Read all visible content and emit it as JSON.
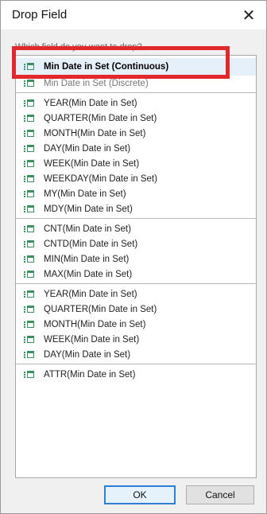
{
  "window": {
    "title": "Drop Field",
    "close_icon": "close-icon"
  },
  "prompt": "Which field do you want to drop?",
  "groups": [
    {
      "items": [
        {
          "label": "Min Date in Set (Continuous)",
          "selected": true
        },
        {
          "label": "Min Date in Set (Discrete)"
        }
      ]
    },
    {
      "items": [
        {
          "label": "YEAR(Min Date in Set)"
        },
        {
          "label": "QUARTER(Min Date in Set)"
        },
        {
          "label": "MONTH(Min Date in Set)"
        },
        {
          "label": "DAY(Min Date in Set)"
        },
        {
          "label": "WEEK(Min Date in Set)"
        },
        {
          "label": "WEEKDAY(Min Date in Set)"
        },
        {
          "label": "MY(Min Date in Set)"
        },
        {
          "label": "MDY(Min Date in Set)"
        }
      ]
    },
    {
      "items": [
        {
          "label": "CNT(Min Date in Set)"
        },
        {
          "label": "CNTD(Min Date in Set)"
        },
        {
          "label": "MIN(Min Date in Set)"
        },
        {
          "label": "MAX(Min Date in Set)"
        }
      ]
    },
    {
      "items": [
        {
          "label": "YEAR(Min Date in Set)"
        },
        {
          "label": "QUARTER(Min Date in Set)"
        },
        {
          "label": "MONTH(Min Date in Set)"
        },
        {
          "label": "WEEK(Min Date in Set)"
        },
        {
          "label": "DAY(Min Date in Set)"
        }
      ]
    },
    {
      "items": [
        {
          "label": "ATTR(Min Date in Set)"
        }
      ]
    }
  ],
  "buttons": {
    "ok": "OK",
    "cancel": "Cancel"
  },
  "colors": {
    "highlight": "#e2282d",
    "icon": "#3d8f5f",
    "selected_bg": "#e6f0fa"
  }
}
